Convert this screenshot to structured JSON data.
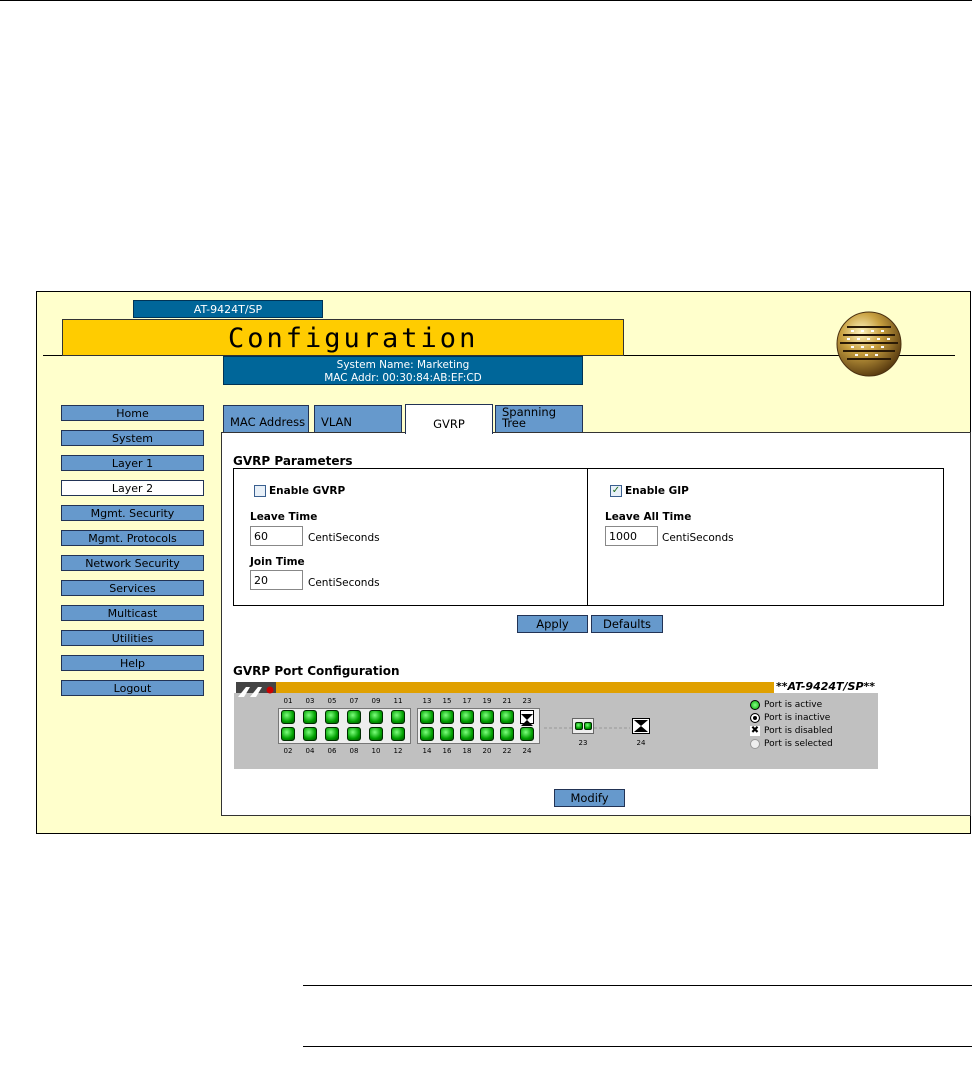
{
  "header": {
    "model_tab": "AT-9424T/SP",
    "title": "Configuration",
    "system_name": "System Name: Marketing",
    "mac_addr": "MAC Addr: 00:30:84:AB:EF:CD"
  },
  "sidebar": {
    "items": [
      {
        "label": "Home"
      },
      {
        "label": "System"
      },
      {
        "label": "Layer 1"
      },
      {
        "label": "Layer 2"
      },
      {
        "label": "Mgmt. Security"
      },
      {
        "label": "Mgmt. Protocols"
      },
      {
        "label": "Network Security"
      },
      {
        "label": "Services"
      },
      {
        "label": "Multicast"
      },
      {
        "label": "Utilities"
      },
      {
        "label": "Help"
      },
      {
        "label": "Logout"
      }
    ],
    "active": "Layer 2"
  },
  "tabs": [
    {
      "label": "MAC Address"
    },
    {
      "label": "VLAN"
    },
    {
      "label": "GVRP"
    },
    {
      "label_line1": "Spanning",
      "label_line2": "Tree"
    }
  ],
  "active_tab": "GVRP",
  "gvrp": {
    "section_title": "GVRP Parameters",
    "enable_gvrp_label": "Enable GVRP",
    "enable_gvrp_checked": false,
    "leave_time_label": "Leave Time",
    "leave_time_value": "60",
    "join_time_label": "Join Time",
    "join_time_value": "20",
    "enable_gip_label": "Enable GIP",
    "enable_gip_checked": true,
    "leave_all_time_label": "Leave All Time",
    "leave_all_time_value": "1000",
    "unit": "CentiSeconds",
    "apply_label": "Apply",
    "defaults_label": "Defaults"
  },
  "port_config": {
    "section_title": "GVRP Port Configuration",
    "panel_model": "**AT-9424T/SP**",
    "top_ports": [
      "01",
      "03",
      "05",
      "07",
      "09",
      "11",
      "13",
      "15",
      "17",
      "19",
      "21",
      "23"
    ],
    "bottom_ports": [
      "02",
      "04",
      "06",
      "08",
      "10",
      "12",
      "14",
      "16",
      "18",
      "20",
      "22",
      "24"
    ],
    "sfp_label_23": "23",
    "sfp_label_24": "24",
    "legend": [
      {
        "label": "Port is active",
        "color": "#00cc00"
      },
      {
        "label": "Port is inactive",
        "color": "#000000"
      },
      {
        "label": "Port is disabled",
        "color": "#ffffff"
      },
      {
        "label": "Port is selected",
        "color": "#dddddd"
      }
    ],
    "modify_label": "Modify"
  }
}
